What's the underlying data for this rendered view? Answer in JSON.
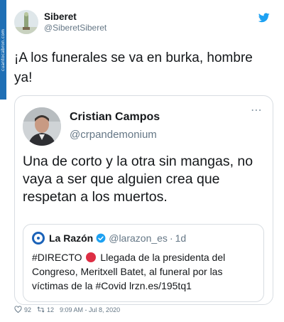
{
  "colors": {
    "text": "#14171a",
    "secondary": "#657786",
    "twitter_blue": "#1da1f2",
    "border": "#d8dde2",
    "red_dot": "#dd2e44",
    "watermark": "#1f6fb5"
  },
  "tweet": {
    "author": {
      "display_name": "Siberet",
      "handle": "@SiberetSiberet",
      "avatar_icon": "avatar-image"
    },
    "brand_icon": "twitter-bird-icon",
    "text": "¡A los funerales se va en burka, hombre ya!",
    "footer": {
      "likes": "92",
      "retweets": "12",
      "timestamp": "9:09 AM - Jul 8, 2020"
    }
  },
  "quoted_tweet": {
    "author": {
      "display_name": "Cristian Campos",
      "handle": "@crpandemonium"
    },
    "text": "Una de corto y la otra sin mangas, no vaya a ser que alguien crea que respetan a los muertos.",
    "nested_quote": {
      "author": {
        "display_name": "La Razón",
        "handle": "@larazon_es",
        "separator": "·",
        "time": "1d"
      },
      "text_prefix": "#DIRECTO",
      "text_body": "Llegada de la presidenta del Congreso, Meritxell Batet, al funeral por las víctimas de la #Covid lrzn.es/195tq1"
    }
  }
}
